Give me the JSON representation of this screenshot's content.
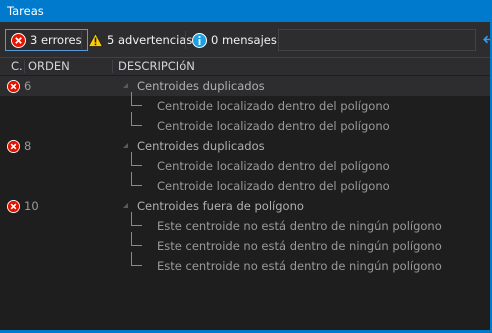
{
  "window": {
    "title": "Tareas"
  },
  "toolbar": {
    "errors_label": "3 errores",
    "warnings_label": "5 advertencias",
    "messages_label": "0 mensajes"
  },
  "columns": {
    "category": "C.",
    "order": "ORDEN",
    "description": "DESCRIPCIóN"
  },
  "groups": [
    {
      "id": "6",
      "description": "Centroides duplicados",
      "children": [
        "Centroide localizado dentro del polígono",
        "Centroide localizado dentro del polígono"
      ]
    },
    {
      "id": "8",
      "description": "Centroides duplicados",
      "children": [
        "Centroide localizado dentro del polígono",
        "Centroide localizado dentro del polígono"
      ]
    },
    {
      "id": "10",
      "description": "Centroides fuera de polígono",
      "children": [
        "Este centroide no está dentro de ningún polígono",
        "Este centroide no está dentro de ningún polígono",
        "Este centroide no está dentro de ningún polígono"
      ]
    }
  ],
  "icons": {
    "error": "error-icon",
    "warning": "warning-icon",
    "info": "info-icon",
    "expander": "collapse-triangle-icon",
    "back": "back-arrow-icon"
  },
  "colors": {
    "accent": "#007acc",
    "error": "#e51400",
    "warning": "#ffcc00",
    "info": "#1ba1e2",
    "background": "#1e1e1e"
  }
}
